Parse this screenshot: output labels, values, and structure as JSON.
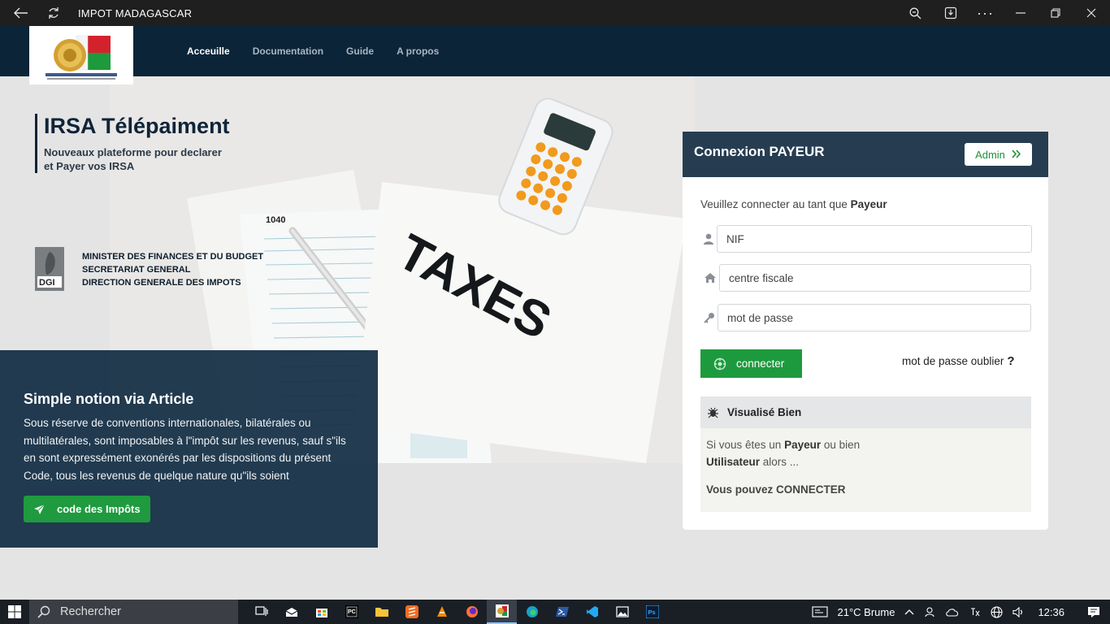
{
  "window": {
    "title": "IMPOT MADAGASCAR"
  },
  "nav": {
    "items": [
      {
        "label": "Acceuille",
        "active": true
      },
      {
        "label": "Documentation"
      },
      {
        "label": "Guide"
      },
      {
        "label": "A propos"
      }
    ]
  },
  "logo": {
    "text": "REPOBLIKAN'I MADAGASIKARA"
  },
  "brand": {
    "title": "IRSA Télépaiment",
    "subtitle_line1": "Nouveaux plateforme pour declarer",
    "subtitle_line2": "et Payer vos IRSA"
  },
  "ministry": {
    "line1": "MINISTER DES FINANCES ET DU BUDGET",
    "line2": "SECRETARIAT GENERAL",
    "line3": "DIRECTION GENERALE DES IMPOTS",
    "logo_text": "DGI"
  },
  "hero": {
    "taxes_text": "TAXES",
    "form_number": "1040"
  },
  "article": {
    "title": "Simple notion via Article",
    "text": "Sous réserve de conventions internationales, bilatérales ou multilatérales, sont imposables à l\"impôt sur les revenus, sauf s\"ils en sont expressément exonérés par les dispositions du présent Code, tous les revenus de quelque nature qu\"ils soient",
    "button_label": "code des Impôts"
  },
  "login": {
    "title": "Connexion PAYEUR",
    "admin_label": "Admin",
    "intro_prefix": "Veuillez connecter au tant que ",
    "intro_role": "Payeur",
    "nif_placeholder": "NIF",
    "centre_placeholder": "centre fiscale",
    "password_placeholder": "mot de passe",
    "connect_label": "connecter",
    "forgot_label": "mot de passe oublier",
    "forgot_q": "?",
    "info": {
      "title": "Visualisé Bien",
      "line1_prefix": "Si vous êtes un ",
      "line1_role": "Payeur",
      "line1_suffix": " ou bien",
      "line2_role": "Utilisateur",
      "line2_suffix": " alors ...",
      "cta": "Vous pouvez CONNECTER"
    }
  },
  "taskbar": {
    "search_placeholder": "Rechercher",
    "weather": "21°C  Brume",
    "time": "12:36"
  },
  "colors": {
    "navbar": "#0b2438",
    "accent_green": "#1f9a3f",
    "login_header": "#263d51"
  }
}
